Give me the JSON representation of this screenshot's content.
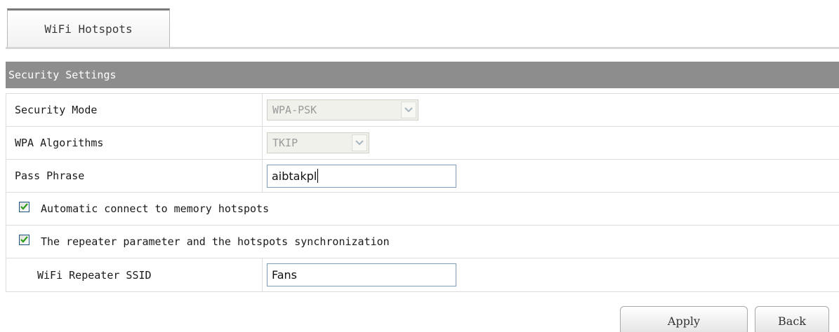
{
  "tabs": [
    {
      "label": "WiFi Hotspots",
      "active": true
    }
  ],
  "section": {
    "title": "Security Settings"
  },
  "form": {
    "security_mode": {
      "label": "Security Mode",
      "value": "WPA-PSK",
      "disabled": true
    },
    "wpa_algorithms": {
      "label": "WPA Algorithms",
      "value": "TKIP",
      "disabled": true
    },
    "pass_phrase": {
      "label": "Pass Phrase",
      "value": "aibtakpl"
    },
    "auto_connect": {
      "label": "Automatic connect to memory hotspots",
      "checked": true
    },
    "repeater_sync": {
      "label": "The repeater parameter and the hotspots synchronization",
      "checked": true
    },
    "repeater_ssid": {
      "label": "WiFi Repeater SSID",
      "value": "Fans"
    }
  },
  "buttons": {
    "apply": "Apply",
    "back": "Back"
  },
  "colors": {
    "section_header_bg": "#8d8d8d",
    "checkmark": "#2a9a18",
    "input_border": "#7f9db9"
  }
}
